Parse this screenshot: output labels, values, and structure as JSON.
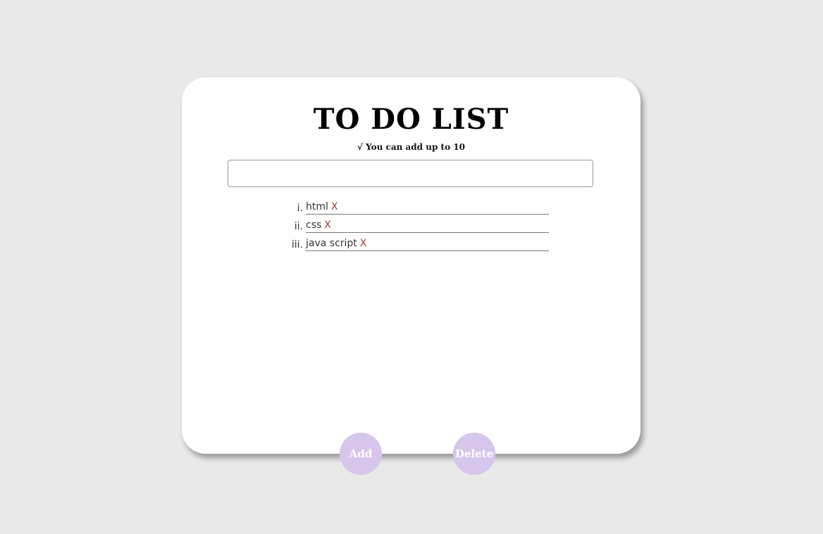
{
  "title": "TO DO LIST",
  "subtitle": "√ You can add up to 10",
  "input": {
    "value": "",
    "placeholder": ""
  },
  "tasks": [
    {
      "number": "i.",
      "text": "html",
      "remove": "X"
    },
    {
      "number": "ii.",
      "text": "css",
      "remove": "X"
    },
    {
      "number": "iii.",
      "text": "java script",
      "remove": "X"
    }
  ],
  "buttons": {
    "add_label": "Add",
    "delete_label": "Delete"
  },
  "colors": {
    "background": "#e9e9e9",
    "card": "#ffffff",
    "button": "#d6c6ec",
    "remove_x": "#a03a3a"
  }
}
